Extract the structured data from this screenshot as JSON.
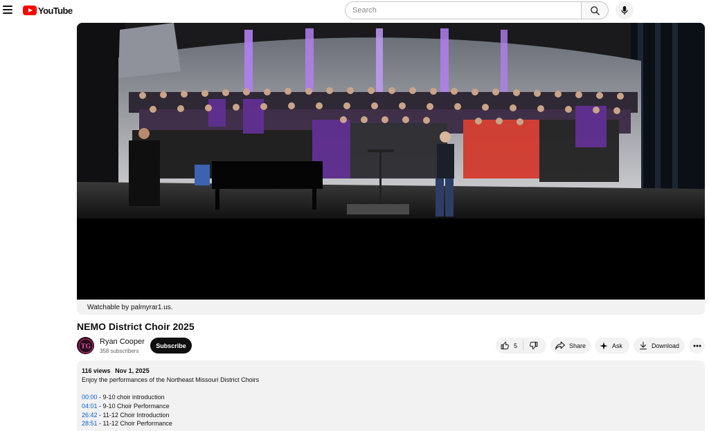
{
  "header": {
    "logo_text": "YouTube",
    "search_placeholder": "Search"
  },
  "player": {
    "watchable_text": "Watchable by palmyrar1.us."
  },
  "video": {
    "title": "NEMO District Choir 2025",
    "channel_name": "Ryan Cooper",
    "channel_avatar_text": "TG",
    "subscribers": "358 subscribers",
    "subscribe_label": "Subscribe",
    "like_count": "5",
    "share_label": "Share",
    "ask_label": "Ask",
    "download_label": "Download"
  },
  "description": {
    "views": "116 views",
    "date": "Nov 1, 2025",
    "text": "Enjoy the performances of the Northeast Missouri District Choirs",
    "chapters": [
      {
        "time": "00:00",
        "label": " - 9-10 choir introduction"
      },
      {
        "time": "04:01",
        "label": " - 9-10 Choir Performance"
      },
      {
        "time": "26:42",
        "label": " - 11-12 Choir Introduction"
      },
      {
        "time": "28:51",
        "label": " - 11-12 Choir Performance"
      }
    ]
  },
  "colors": {
    "brand_red": "#ff0000",
    "link_blue": "#065fd4",
    "choir_purple": "#5b2a8c",
    "choir_red": "#d23b2e",
    "stage_light": "#b07ff0"
  }
}
